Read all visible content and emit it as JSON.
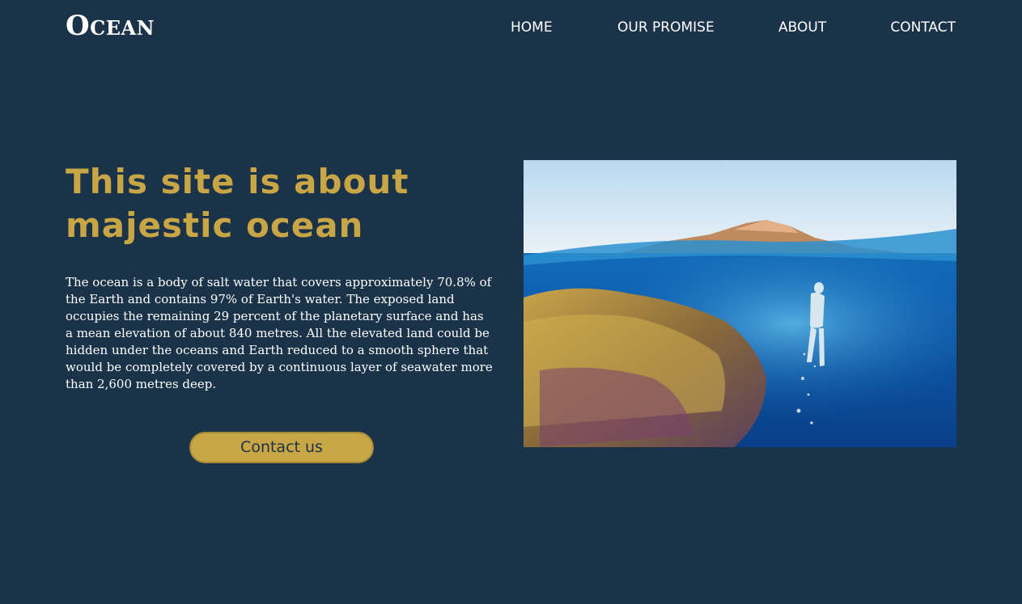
{
  "site": {
    "logo": "Ocean"
  },
  "nav": {
    "home": "HOME",
    "promise": "OUR PROMISE",
    "about": "ABOUT",
    "contact": "CONTACT"
  },
  "hero": {
    "title": "This site is about majestic ocean",
    "body": "The ocean is a body of salt water that covers approximately 70.8% of the Earth and contains 97% of Earth's water. The exposed land occupies the remaining 29 percent of the planetary surface and has a mean elevation of about 840 metres. All the elevated land could be hidden under the oceans and Earth reduced to a smooth sphere that would be completely covered by a continuous layer of seawater more than 2,600 metres deep.",
    "cta_label": "Contact us",
    "image_subject": "split-view photo: mountain above waterline, coral reef and swimmer underwater"
  },
  "colors": {
    "background": "#1b3349",
    "accent_gold": "#c8a545",
    "text": "#ffffff"
  }
}
